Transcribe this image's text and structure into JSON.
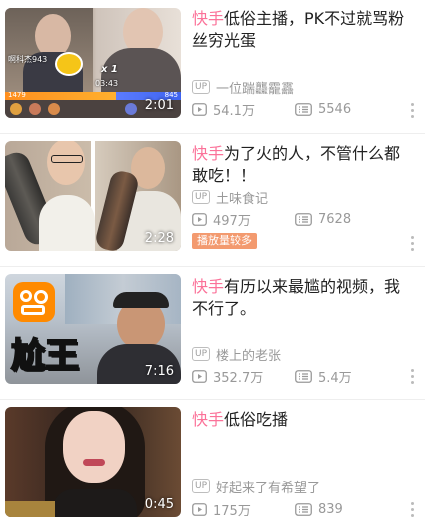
{
  "videos": [
    {
      "title_keyword": "快手",
      "title_rest": "低俗主播，PK不过就骂粉丝穷光蛋",
      "uploader": "一位踹龘靇靐",
      "views": "54.1万",
      "danmaku": "5546",
      "duration": "2:01",
      "overlay": {
        "streamer": "啊科杰943",
        "multiplier": "x 1",
        "time": "03:43",
        "score_left": "1479",
        "score_right": "845"
      }
    },
    {
      "title_keyword": "快手",
      "title_rest": "为了火的人，不管什么都敢吃！！",
      "uploader": "土味食记",
      "views": "497万",
      "danmaku": "7628",
      "duration": "2:28",
      "tag": "播放量较多"
    },
    {
      "title_keyword": "快手",
      "title_rest": "有历以来最尴的视频，我不行了。",
      "uploader": "楼上的老张",
      "views": "352.7万",
      "danmaku": "5.4万",
      "duration": "7:16",
      "overlay": {
        "caption": "尬王"
      }
    },
    {
      "title_keyword": "快手",
      "title_rest": "低俗吃播",
      "uploader": "好起来了有希望了",
      "views": "175万",
      "danmaku": "839",
      "duration": "0:45"
    }
  ],
  "labels": {
    "up_badge": "UP"
  },
  "colors": {
    "keyword": "#fb7299",
    "tag_bg": "#f39a6f",
    "meta": "#999999"
  }
}
